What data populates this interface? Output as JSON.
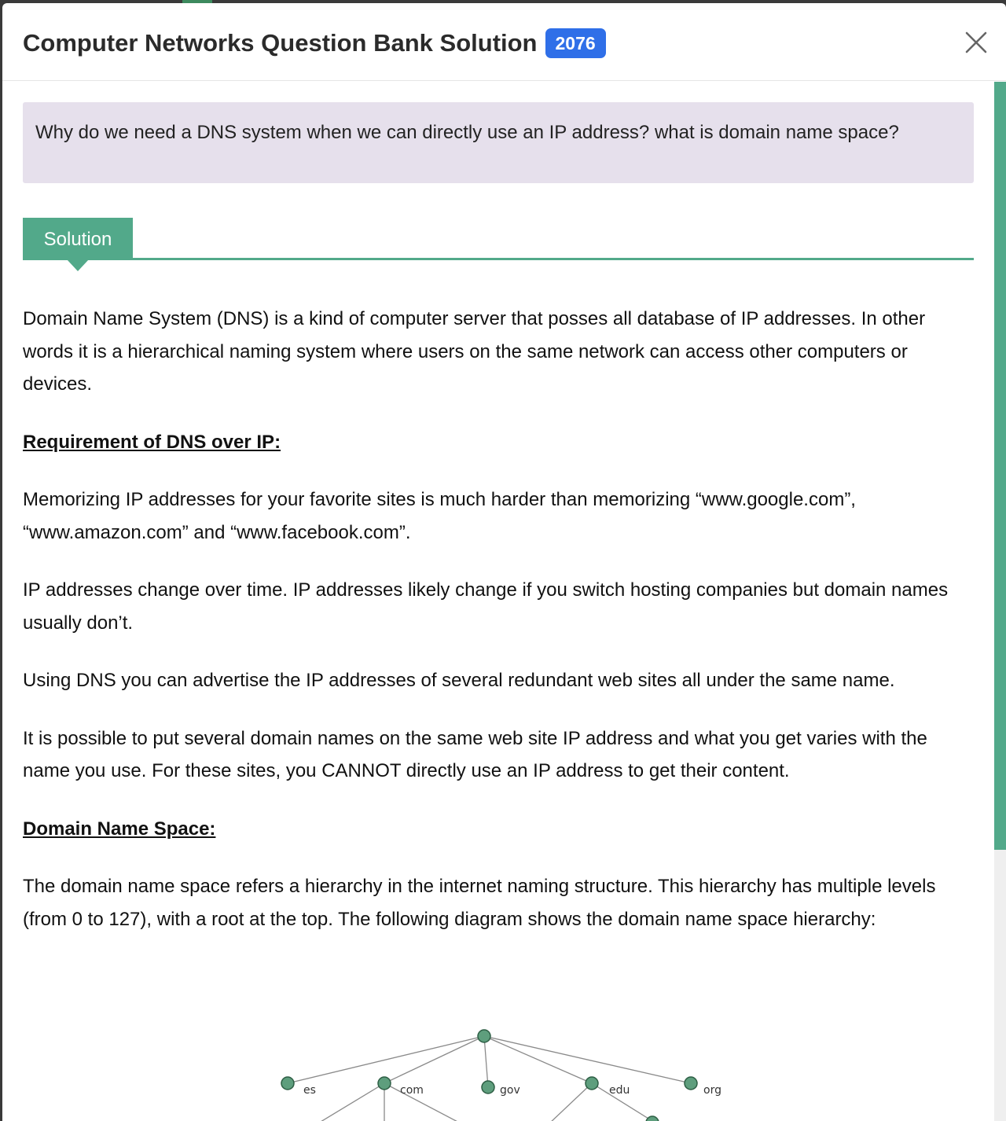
{
  "modal": {
    "title": "Computer Networks Question Bank Solution",
    "year_badge": "2076",
    "close_icon": "close-icon"
  },
  "question": "Why do we need a DNS system when we can directly use an IP address? what is domain name space?",
  "solution_tab": "Solution",
  "body": {
    "intro": "Domain Name System (DNS) is a kind of computer server that posses all database of IP addresses. In other words it is a hierarchical naming system where users on the same network can access other computers or devices.",
    "heading_requirement": "Requirement of DNS over IP:",
    "req_1": "Memorizing IP addresses for your favorite sites is much harder than memorizing “www.google.com”, “www.amazon.com” and “www.facebook.com”.",
    "req_2": "IP addresses change over time. IP addresses likely change if you switch hosting companies but domain names usually don’t.",
    "req_3": "Using DNS you can advertise the IP addresses of several redundant web sites all under the same name.",
    "req_4": "It is possible to put several domain names on the same web site IP address and what you get varies with the name you use. For these sites, you CANNOT directly use an IP address to get their content.",
    "heading_space": "Domain Name Space:",
    "space_desc": "The domain name space refers a hierarchy in the internet naming structure. This hierarchy has multiple levels (from 0 to 127), with a root at the top. The following diagram shows the domain name space hierarchy:"
  },
  "diagram": {
    "labels": {
      "es": "es",
      "com": "com",
      "gov": "gov",
      "edu": "edu",
      "org": "org"
    }
  },
  "colors": {
    "accent_green": "#52a98a",
    "badge_blue": "#2f6fe8",
    "question_bg": "#e6e0ec"
  }
}
